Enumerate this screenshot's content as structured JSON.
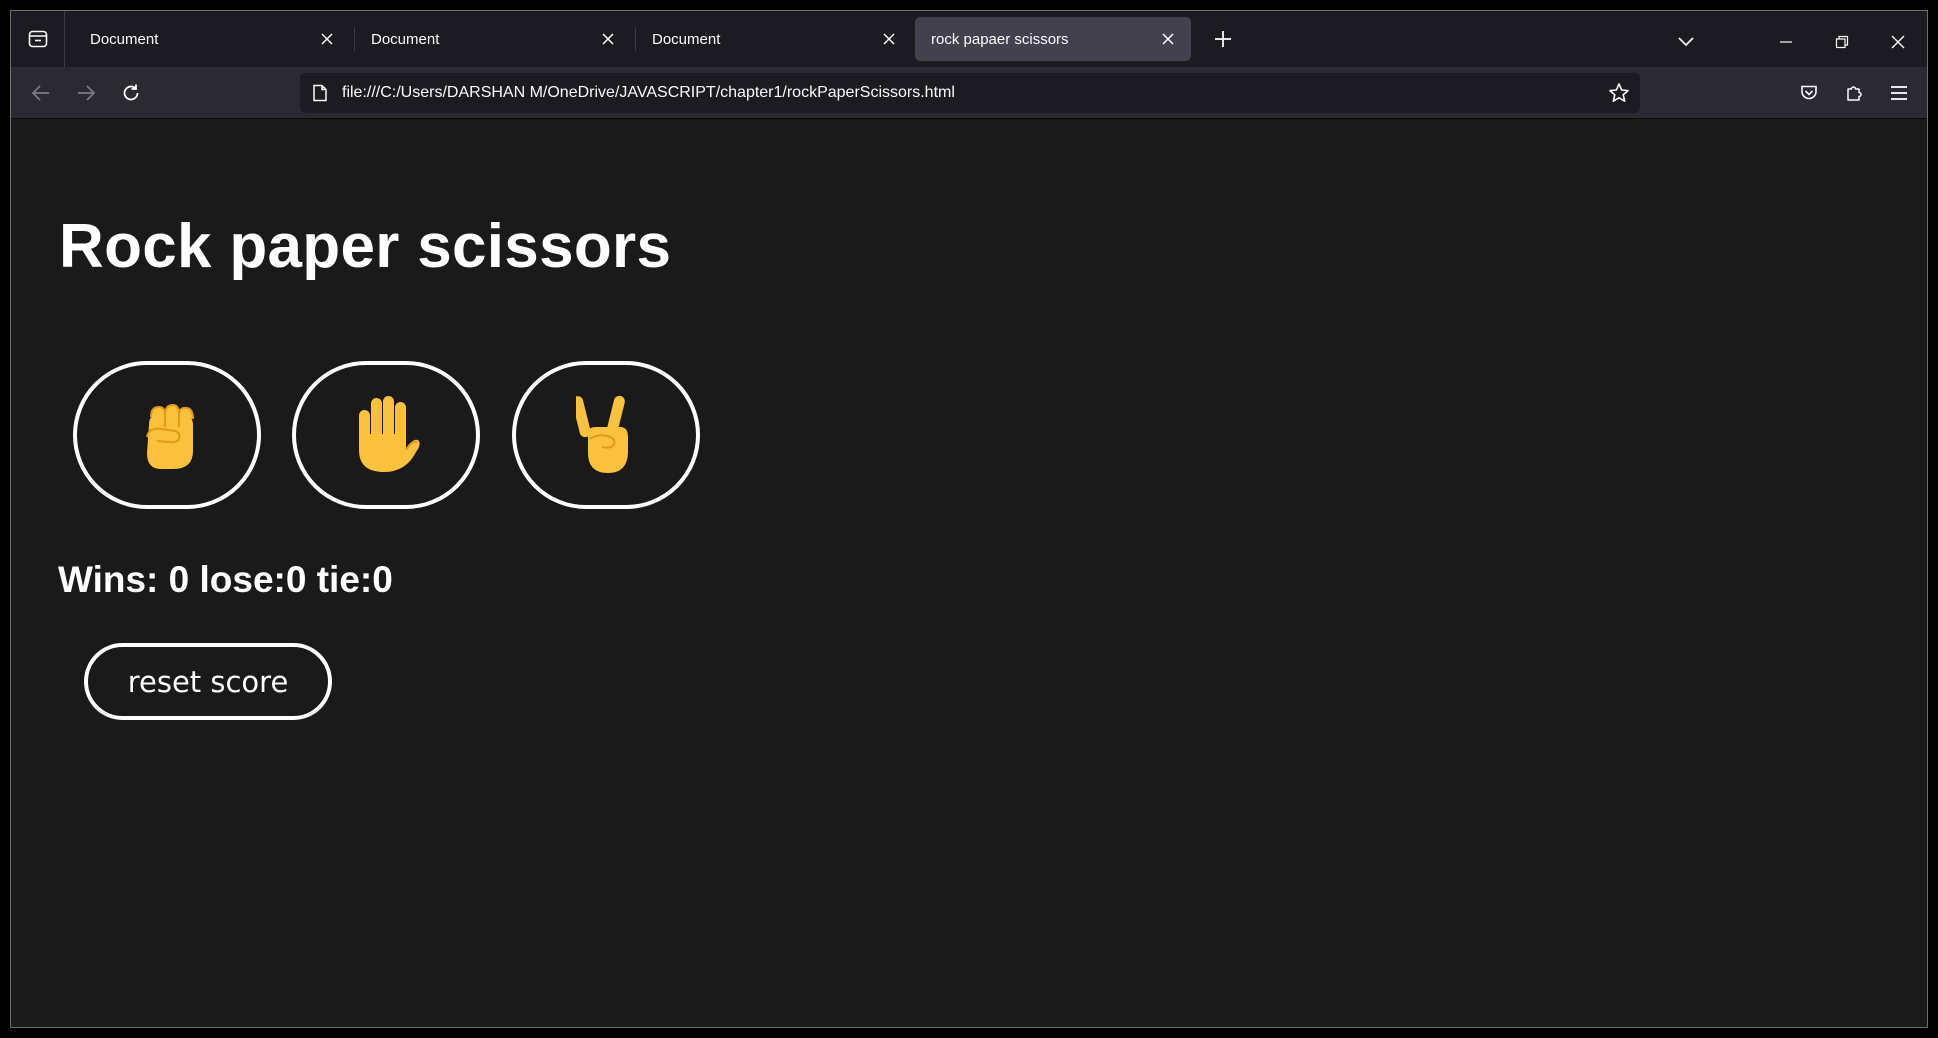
{
  "browser": {
    "tabs": [
      {
        "title": "Document",
        "active": false
      },
      {
        "title": "Document",
        "active": false
      },
      {
        "title": "Document",
        "active": false
      },
      {
        "title": "rock papaer scissors",
        "active": true
      }
    ],
    "url": "file:///C:/Users/DARSHAN M/OneDrive/JAVASCRIPT/chapter1/rockPaperScissors.html"
  },
  "page": {
    "title": "Rock paper scissors",
    "moves": [
      {
        "name": "rock",
        "icon": "fist-icon"
      },
      {
        "name": "paper",
        "icon": "raised-hand-icon"
      },
      {
        "name": "scissors",
        "icon": "victory-hand-icon"
      }
    ],
    "score_text": "Wins: 0 lose:0 tie:0",
    "reset_label": "reset score"
  },
  "colors": {
    "page_bg": "#1a1a1a",
    "tabbar_bg": "#1c1b22",
    "navbar_bg": "#2b2a33",
    "active_tab": "#42414d",
    "emoji_yellow": "#f9c13c"
  }
}
